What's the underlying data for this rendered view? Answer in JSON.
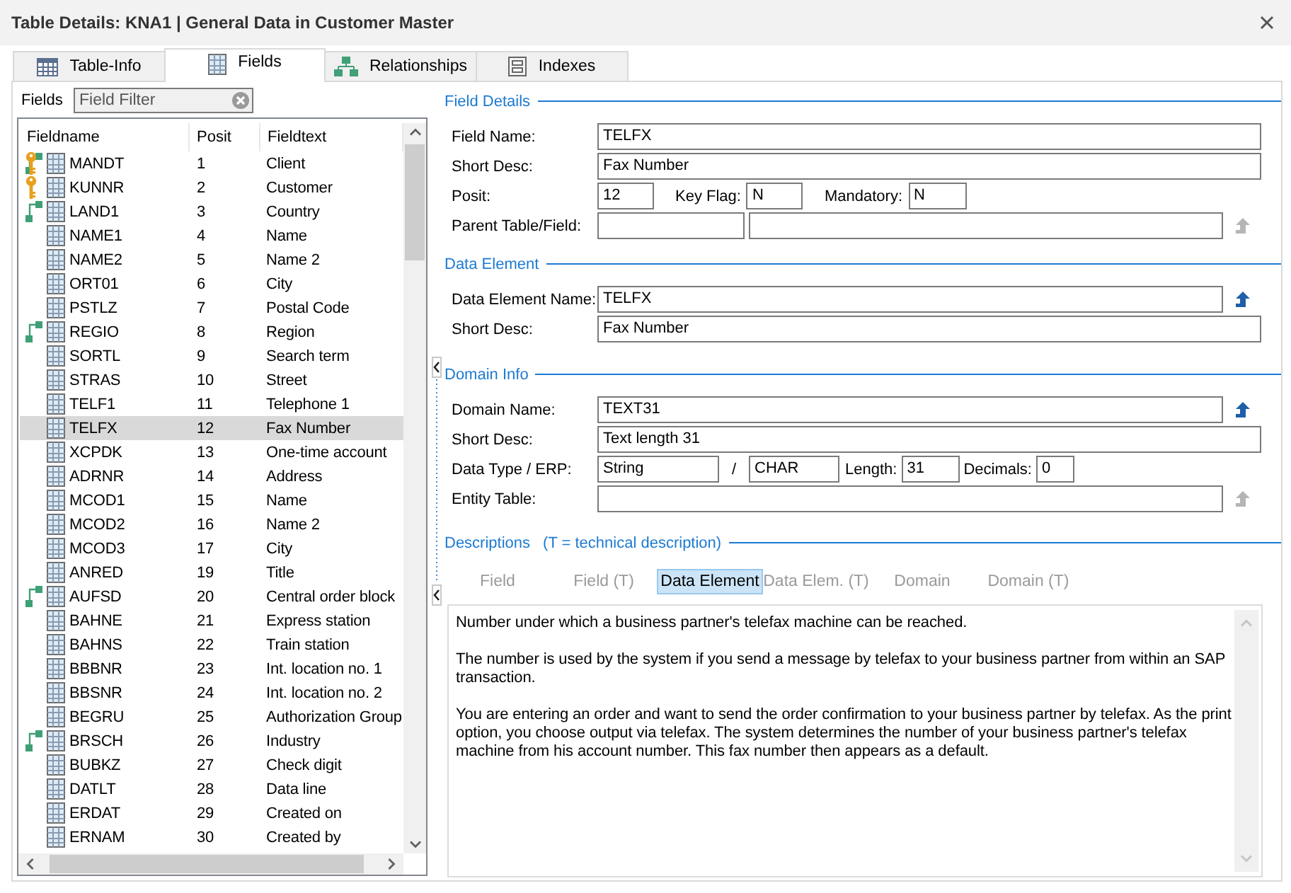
{
  "window": {
    "title": "Table Details: KNA1 | General Data in Customer Master"
  },
  "tabs": [
    {
      "label": "Table-Info",
      "selected": false
    },
    {
      "label": "Fields",
      "selected": true
    },
    {
      "label": "Relationships",
      "selected": false
    },
    {
      "label": "Indexes",
      "selected": false
    }
  ],
  "fields_panel": {
    "label": "Fields",
    "filter": {
      "placeholder": "Field Filter"
    },
    "columns": [
      "Fieldname",
      "Posit",
      "Fieldtext"
    ],
    "rows": [
      {
        "name": "MANDT",
        "posit": "1",
        "text": "Client",
        "key": true,
        "relation": true,
        "selected": false
      },
      {
        "name": "KUNNR",
        "posit": "2",
        "text": "Customer",
        "key": true,
        "relation": false,
        "selected": false
      },
      {
        "name": "LAND1",
        "posit": "3",
        "text": "Country",
        "key": false,
        "relation": true,
        "selected": false
      },
      {
        "name": "NAME1",
        "posit": "4",
        "text": "Name",
        "key": false,
        "relation": false,
        "selected": false
      },
      {
        "name": "NAME2",
        "posit": "5",
        "text": "Name 2",
        "key": false,
        "relation": false,
        "selected": false
      },
      {
        "name": "ORT01",
        "posit": "6",
        "text": "City",
        "key": false,
        "relation": false,
        "selected": false
      },
      {
        "name": "PSTLZ",
        "posit": "7",
        "text": "Postal Code",
        "key": false,
        "relation": false,
        "selected": false
      },
      {
        "name": "REGIO",
        "posit": "8",
        "text": "Region",
        "key": false,
        "relation": true,
        "selected": false
      },
      {
        "name": "SORTL",
        "posit": "9",
        "text": "Search term",
        "key": false,
        "relation": false,
        "selected": false
      },
      {
        "name": "STRAS",
        "posit": "10",
        "text": "Street",
        "key": false,
        "relation": false,
        "selected": false
      },
      {
        "name": "TELF1",
        "posit": "11",
        "text": "Telephone 1",
        "key": false,
        "relation": false,
        "selected": false
      },
      {
        "name": "TELFX",
        "posit": "12",
        "text": "Fax Number",
        "key": false,
        "relation": false,
        "selected": true
      },
      {
        "name": "XCPDK",
        "posit": "13",
        "text": "One-time account",
        "key": false,
        "relation": false,
        "selected": false
      },
      {
        "name": "ADRNR",
        "posit": "14",
        "text": "Address",
        "key": false,
        "relation": false,
        "selected": false
      },
      {
        "name": "MCOD1",
        "posit": "15",
        "text": "Name",
        "key": false,
        "relation": false,
        "selected": false
      },
      {
        "name": "MCOD2",
        "posit": "16",
        "text": "Name 2",
        "key": false,
        "relation": false,
        "selected": false
      },
      {
        "name": "MCOD3",
        "posit": "17",
        "text": "City",
        "key": false,
        "relation": false,
        "selected": false
      },
      {
        "name": "ANRED",
        "posit": "19",
        "text": "Title",
        "key": false,
        "relation": false,
        "selected": false
      },
      {
        "name": "AUFSD",
        "posit": "20",
        "text": "Central order block",
        "key": false,
        "relation": true,
        "selected": false
      },
      {
        "name": "BAHNE",
        "posit": "21",
        "text": "Express station",
        "key": false,
        "relation": false,
        "selected": false
      },
      {
        "name": "BAHNS",
        "posit": "22",
        "text": "Train station",
        "key": false,
        "relation": false,
        "selected": false
      },
      {
        "name": "BBBNR",
        "posit": "23",
        "text": "Int. location no. 1",
        "key": false,
        "relation": false,
        "selected": false
      },
      {
        "name": "BBSNR",
        "posit": "24",
        "text": "Int. location no. 2",
        "key": false,
        "relation": false,
        "selected": false
      },
      {
        "name": "BEGRU",
        "posit": "25",
        "text": "Authorization Group",
        "key": false,
        "relation": false,
        "selected": false
      },
      {
        "name": "BRSCH",
        "posit": "26",
        "text": "Industry",
        "key": false,
        "relation": true,
        "selected": false
      },
      {
        "name": "BUBKZ",
        "posit": "27",
        "text": "Check digit",
        "key": false,
        "relation": false,
        "selected": false
      },
      {
        "name": "DATLT",
        "posit": "28",
        "text": "Data line",
        "key": false,
        "relation": false,
        "selected": false
      },
      {
        "name": "ERDAT",
        "posit": "29",
        "text": "Created on",
        "key": false,
        "relation": false,
        "selected": false
      },
      {
        "name": "ERNAM",
        "posit": "30",
        "text": "Created by",
        "key": false,
        "relation": false,
        "selected": false
      }
    ]
  },
  "field_details": {
    "title": "Field Details",
    "field_name": {
      "label": "Field Name:",
      "value": "TELFX"
    },
    "short_desc": {
      "label": "Short Desc:",
      "value": "Fax Number"
    },
    "posit": {
      "label": "Posit:",
      "value": "12"
    },
    "key_flag": {
      "label": "Key Flag:",
      "value": "N"
    },
    "mandatory": {
      "label": "Mandatory:",
      "value": "N"
    },
    "parent": {
      "label": "Parent Table/Field:",
      "jump_enabled": false
    }
  },
  "data_element": {
    "title": "Data Element",
    "name": {
      "label": "Data Element Name:",
      "value": "TELFX",
      "jump_enabled": true
    },
    "short_desc": {
      "label": "Short Desc:",
      "value": "Fax Number"
    }
  },
  "domain_info": {
    "title": "Domain Info",
    "name": {
      "label": "Domain Name:",
      "value": "TEXT31",
      "jump_enabled": true
    },
    "short_desc": {
      "label": "Short Desc:",
      "value": "Text length 31"
    },
    "data_type": {
      "label": "Data Type / ERP:",
      "value": "String",
      "separator": "/",
      "erp": "CHAR"
    },
    "length": {
      "label": "Length:",
      "value": "31"
    },
    "decimals": {
      "label": "Decimals:",
      "value": "0"
    },
    "entity_table": {
      "label": "Entity Table:",
      "jump_enabled": false
    }
  },
  "descriptions": {
    "title": "Descriptions",
    "note": "(T = technical description)",
    "tabs": [
      {
        "label": "Field",
        "selected": false
      },
      {
        "label": "Field (T)",
        "selected": false
      },
      {
        "label": "Data Element",
        "selected": true
      },
      {
        "label": "Data Elem. (T)",
        "selected": false
      },
      {
        "label": "Domain",
        "selected": false
      },
      {
        "label": "Domain (T)",
        "selected": false
      }
    ],
    "text": [
      "Number under which a business partner's telefax machine can be reached.",
      "The number is used by the system if you send a message by telefax to your business partner from within an SAP transaction.",
      "You are entering an order and want to send the order confirmation to your business partner by telefax. As the print option, you choose output via telefax. The system determines the number of your business partner's telefax machine from his account number. This fax number then appears as a default."
    ]
  }
}
